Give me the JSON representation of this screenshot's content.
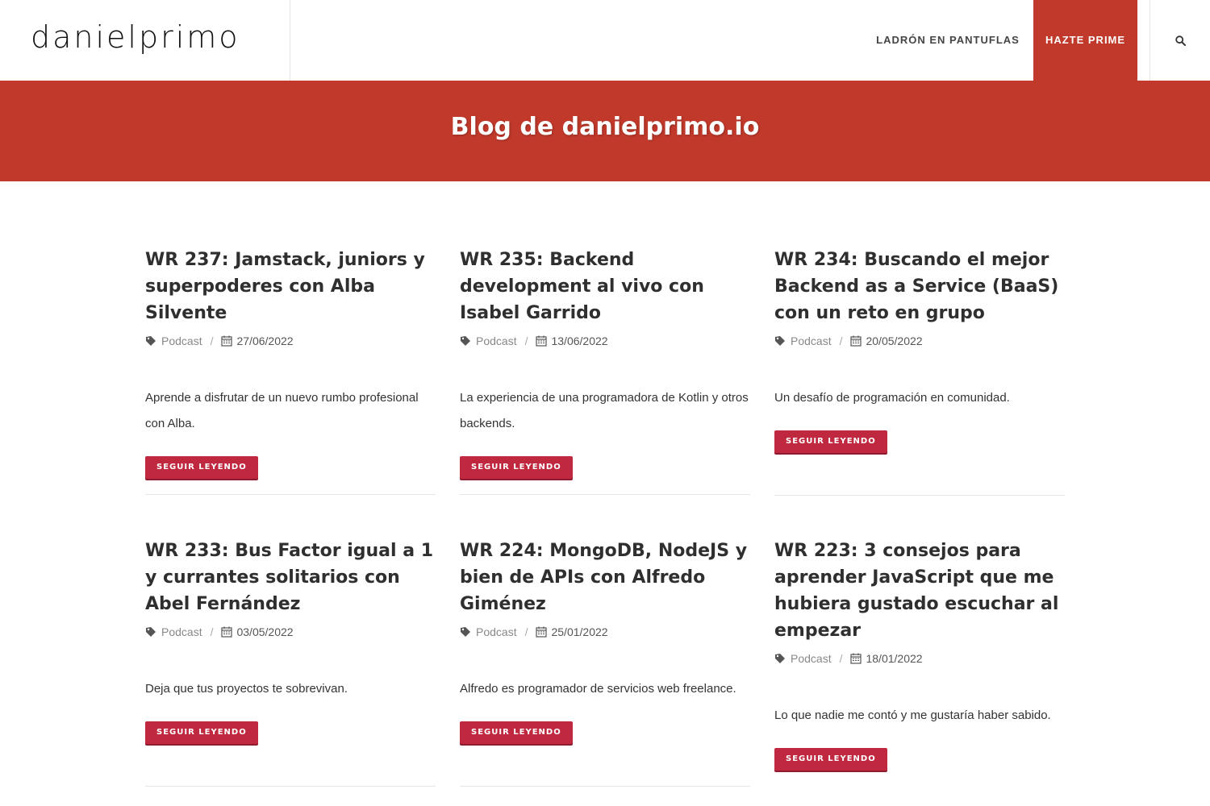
{
  "header": {
    "logo": "danielprimo",
    "nav": {
      "ladron": "LADRÓN EN PANTUFLAS",
      "prime": "HAZTE PRIME"
    },
    "search_icon": "search-icon"
  },
  "hero": {
    "title": "Blog de danielprimo.io"
  },
  "colors": {
    "accent": "#c0392b",
    "button": "#c0283f"
  },
  "posts": [
    {
      "title": "WR 237: Jamstack, juniors y superpoderes con Alba Silvente",
      "category": "Podcast",
      "date": "27/06/2022",
      "excerpt": "Aprende a disfrutar de un nuevo rumbo profesional con Alba.",
      "button": "SEGUIR LEYENDO"
    },
    {
      "title": "WR 235: Backend development al vivo con Isabel Garrido",
      "category": "Podcast",
      "date": "13/06/2022",
      "excerpt": "La experiencia de una programadora de Kotlin y otros backends.",
      "button": "SEGUIR LEYENDO"
    },
    {
      "title": "WR 234: Buscando el mejor Backend as a Service (BaaS) con un reto en grupo",
      "category": "Podcast",
      "date": "20/05/2022",
      "excerpt": "Un desafío de programación en comunidad.",
      "button": "SEGUIR LEYENDO"
    },
    {
      "title": "WR 233: Bus Factor igual a 1 y currantes solitarios con Abel Fernández",
      "category": "Podcast",
      "date": "03/05/2022",
      "excerpt": "Deja que tus proyectos te sobrevivan.",
      "button": "SEGUIR LEYENDO"
    },
    {
      "title": "WR 224: MongoDB, NodeJS y bien de APIs con Alfredo Giménez",
      "category": "Podcast",
      "date": "25/01/2022",
      "excerpt": "Alfredo es programador de servicios web freelance.",
      "button": "SEGUIR LEYENDO"
    },
    {
      "title": "WR 223: 3 consejos para aprender JavaScript que me hubiera gustado escuchar al empezar",
      "category": "Podcast",
      "date": "18/01/2022",
      "excerpt": "Lo que nadie me contó y me gustaría haber sabido.",
      "button": "SEGUIR LEYENDO"
    }
  ]
}
